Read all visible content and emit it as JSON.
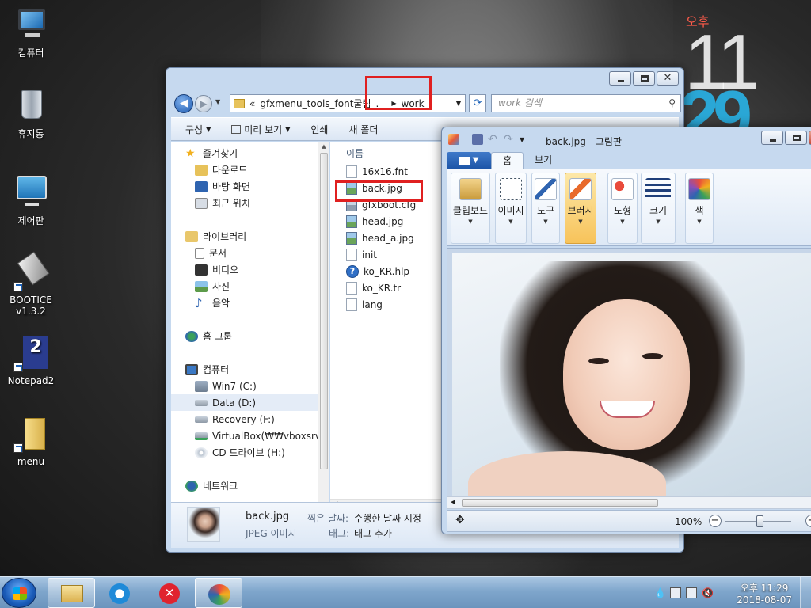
{
  "desktop": {
    "icons": [
      {
        "label": "컴퓨터"
      },
      {
        "label": "휴지통"
      },
      {
        "label": "제어판"
      },
      {
        "label": "BOOTICE\nv1.3.2"
      },
      {
        "label": "Notepad2"
      },
      {
        "label": "menu"
      }
    ],
    "clock": {
      "ampm": "오후",
      "hour": "11",
      "minute": "29"
    }
  },
  "explorer": {
    "address": {
      "prefix": "«",
      "folder": "gfxmenu_tools_font굴림_...",
      "current": "work"
    },
    "search_placeholder": "work 검색",
    "toolbar": {
      "organize": "구성",
      "preview": "미리 보기",
      "print": "인쇄",
      "new_folder": "새 폴더"
    },
    "nav": {
      "favorites": "즐겨찾기",
      "downloads": "다운로드",
      "desktop": "바탕 화면",
      "recent": "최근 위치",
      "libraries": "라이브러리",
      "documents": "문서",
      "videos": "비디오",
      "pictures": "사진",
      "music": "음악",
      "homegroup": "홈 그룹",
      "computer": "컴퓨터",
      "win7": "Win7 (C:)",
      "data": "Data (D:)",
      "recovery": "Recovery (F:)",
      "virtualbox": "VirtualBox(₩₩vboxsrv) (",
      "cd": "CD 드라이브 (H:)",
      "network": "네트워크"
    },
    "column_name": "이름",
    "files": [
      "16x16.fnt",
      "back.jpg",
      "gfxboot.cfg",
      "head.jpg",
      "head_a.jpg",
      "init",
      "ko_KR.hlp",
      "ko_KR.tr",
      "lang"
    ],
    "details": {
      "name": "back.jpg",
      "type": "JPEG 이미지",
      "date_key": "찍은 날짜:",
      "date_value": "수행한 날짜 지정",
      "tag_key": "태그:",
      "tag_value": "태그 추가"
    }
  },
  "paint": {
    "title": "back.jpg - 그림판",
    "tabs": {
      "home": "홈",
      "view": "보기"
    },
    "groups": {
      "clipboard": "클립보드",
      "image": "이미지",
      "tools": "도구",
      "brushes": "브러시",
      "shapes": "도형",
      "size": "크기",
      "color": "색"
    },
    "zoom": "100%"
  },
  "taskbar": {
    "time": "오후 11:29",
    "date": "2018-08-07"
  },
  "colors": {
    "highlight": "#e02020",
    "accent": "#1d56a8"
  }
}
